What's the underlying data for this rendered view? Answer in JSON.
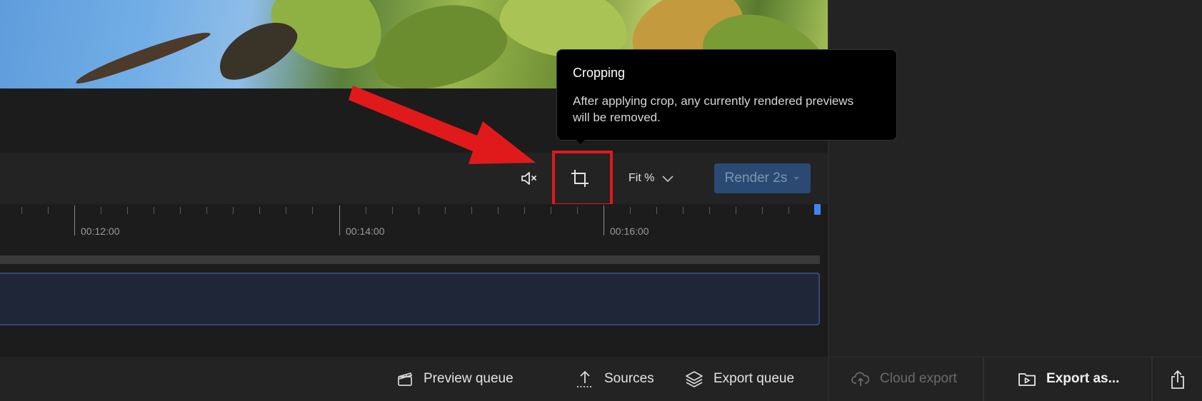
{
  "toolbar": {
    "zoom_label": "Fit %",
    "render_label": "Render 2s"
  },
  "icons": {
    "mute": "speaker-muted-icon",
    "crop": "crop-icon",
    "chevron": "chevron-down-icon"
  },
  "tooltip": {
    "title": "Cropping",
    "body": "After applying crop, any currently rendered previews will be removed."
  },
  "timeline": {
    "time_labels": [
      "00:12:00",
      "00:14:00",
      "00:16:00"
    ]
  },
  "bottom_bar": {
    "preview_queue": "Preview queue",
    "sources": "Sources",
    "export_queue": "Export queue",
    "cloud_export": "Cloud export",
    "export_as": "Export as..."
  },
  "colors": {
    "accent": "#3d86f0",
    "highlight": "#e0191b",
    "render_button": "#2b4a73",
    "clip_border": "#364a78"
  }
}
